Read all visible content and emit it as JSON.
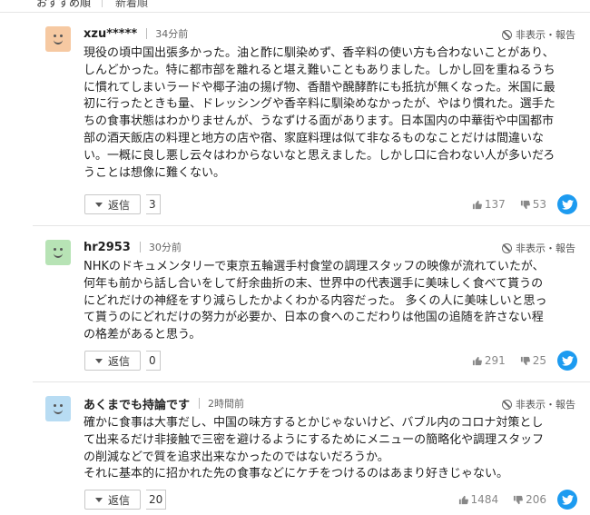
{
  "sort_tabs": {
    "recommended": "おすすめ順",
    "newest": "新着順"
  },
  "colors": {
    "accent": "#1d9bf0",
    "avatar_orange": "#f6c9a2",
    "avatar_green": "#b7e3b5",
    "avatar_blue": "#b8dcf3"
  },
  "comments": [
    {
      "username": "xzu*****",
      "time": "34分前",
      "report_label": "非表示・報告",
      "avatar_icon": "smiley-face-icon",
      "lines": [
        "現役の頃中国出張多かった。油と酢に馴染めず、香辛料の使い方も合わないことがあり、",
        "しんどかった。特に都市部を離れると堪え難いこともありました。しかし回を重ねるうち",
        "に慣れてしまいラードや椰子油の揚げ物、香醋や醗酵酢にも抵抗が無くなった。米国に最",
        "初に行ったときも量、ドレッシングや香辛料に馴染めなかったが、やはり慣れた。選手た",
        "ちの食事状態はわかりませんが、うなずける面があります。日本国内の中華街や中国都市",
        "部の酒天飯店の料理と地方の店や宿、家庭料理は似て非なるものなことだけは間違いな",
        "い。一概に良し悪し云々はわからないなと思えました。しかし口に合わない人が多いだろ",
        "うことは想像に難くない。"
      ],
      "reply_label": "返信",
      "reply_count": "3",
      "likes": "137",
      "dislikes": "53"
    },
    {
      "username": "hr2953",
      "time": "30分前",
      "report_label": "非表示・報告",
      "avatar_icon": "smiley-face-icon",
      "lines": [
        "NHKのドキュメンタリーで東京五輪選手村食堂の調理スタッフの映像が流れていたが、",
        "何年も前から話し合いをして紆余曲折の末、世界中の代表選手に美味しく食べて貰うの",
        "にどれだけの神経をすり減らしたかよくわかる内容だった。 多くの人に美味しいと思っ",
        "て貰うのにどれだけの努力が必要か、日本の食へのこだわりは他国の追随を許さない程",
        "の格差があると思う。"
      ],
      "reply_label": "返信",
      "reply_count": "0",
      "likes": "291",
      "dislikes": "25"
    },
    {
      "username": "あくまでも持論です",
      "time": "2時間前",
      "report_label": "非表示・報告",
      "avatar_icon": "smiley-face-icon",
      "lines": [
        "確かに食事は大事だし、中国の味方するとかじゃないけど、バブル内のコロナ対策とし",
        "て出来るだけ非接触で三密を避けるようにするためにメニューの簡略化や調理スタッフ",
        "の削減などで質を追求出来なかったのではないだろうか。",
        "それに基本的に招かれた先の食事などにケチをつけるのはあまり好きじゃない。"
      ],
      "reply_label": "返信",
      "reply_count": "20",
      "likes": "1484",
      "dislikes": "206"
    }
  ]
}
